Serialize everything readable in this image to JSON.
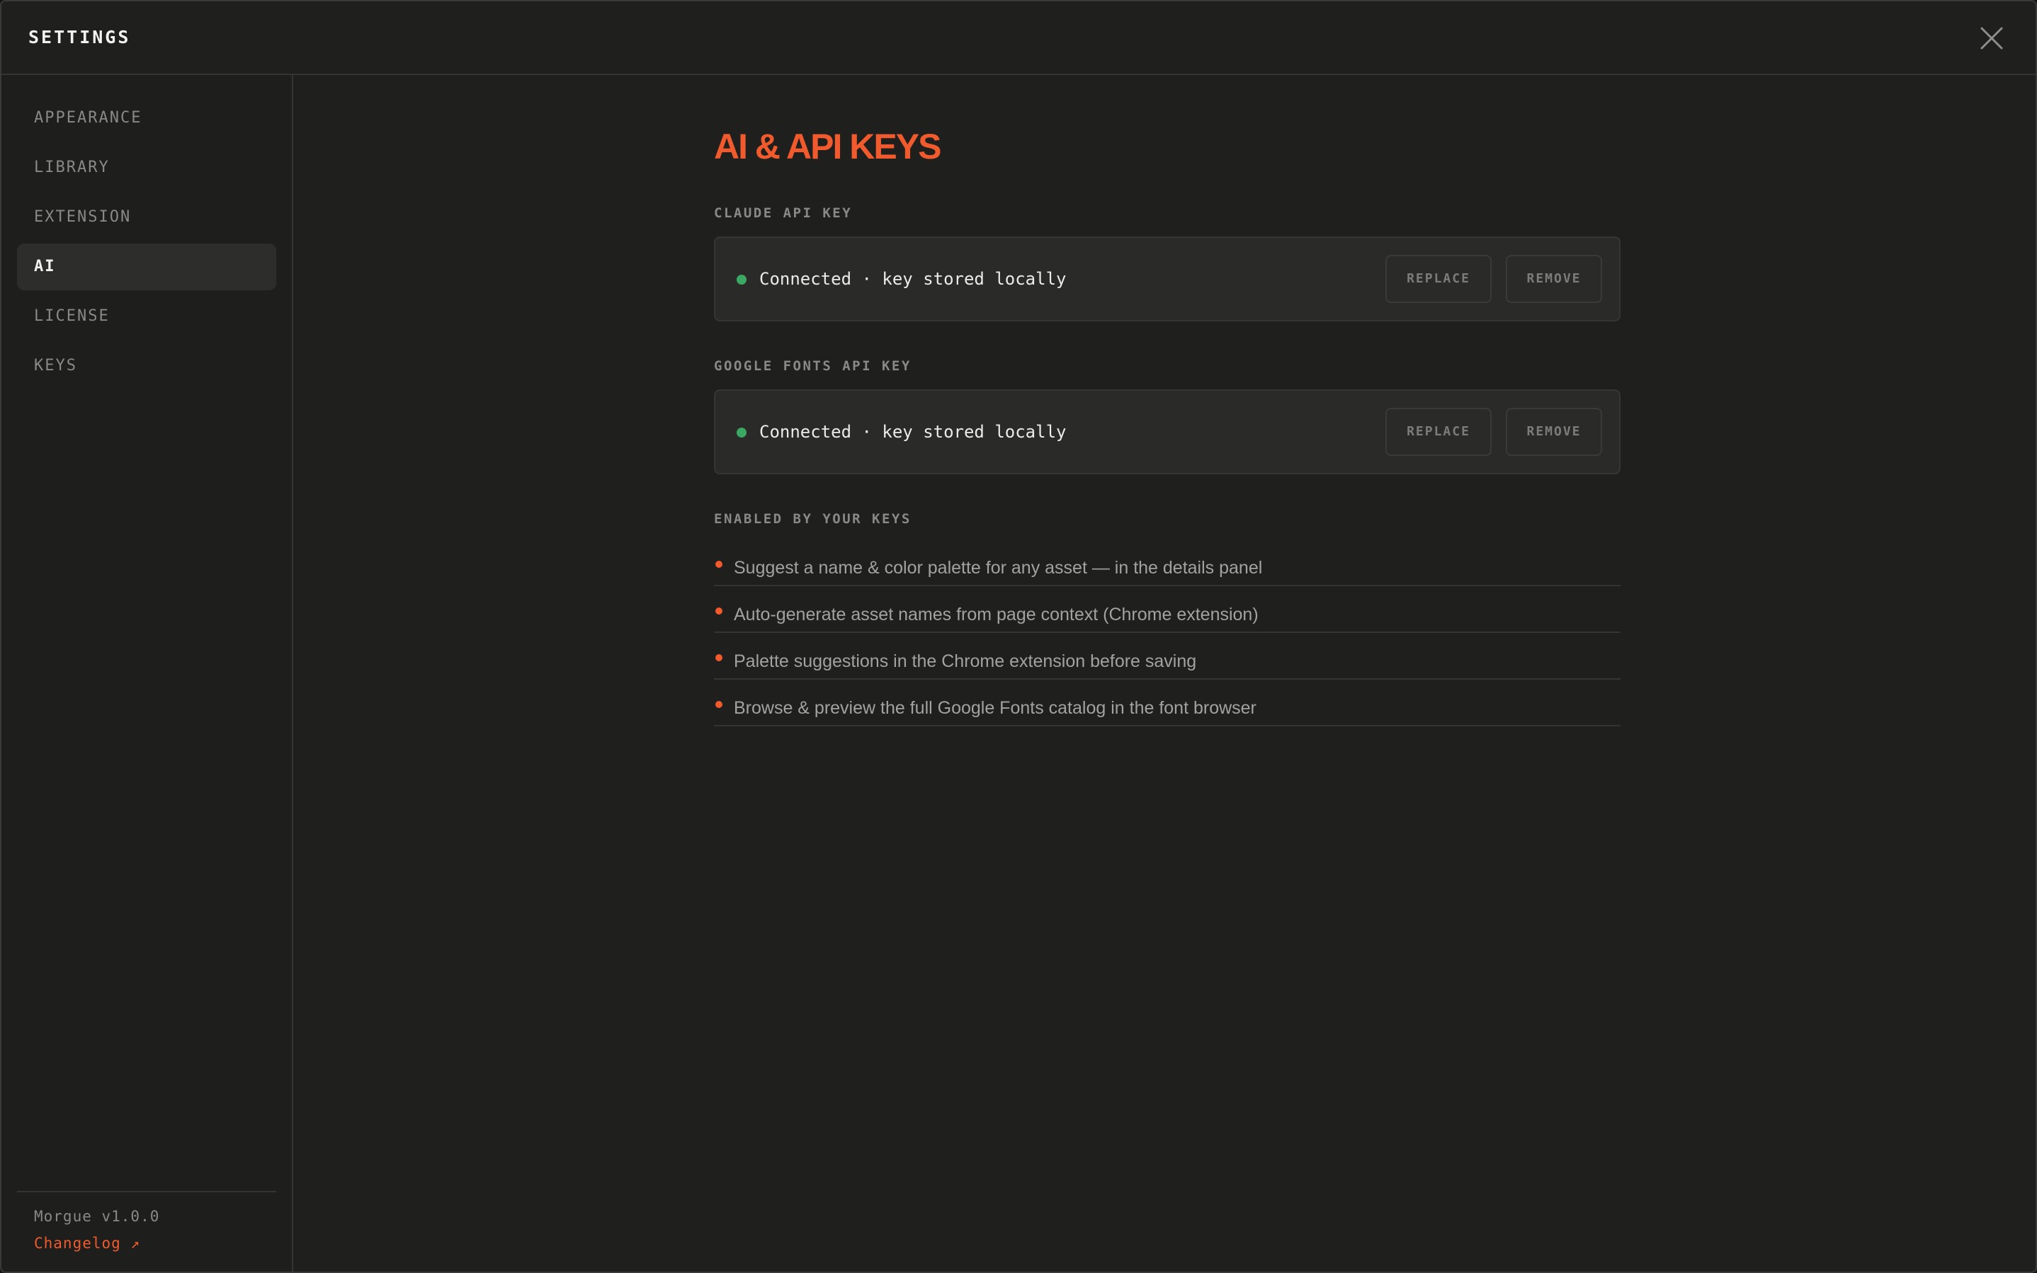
{
  "header": {
    "title": "SETTINGS",
    "close_icon": "close-icon"
  },
  "sidebar": {
    "items": [
      {
        "label": "APPEARANCE",
        "active": false
      },
      {
        "label": "LIBRARY",
        "active": false
      },
      {
        "label": "EXTENSION",
        "active": false
      },
      {
        "label": "AI",
        "active": true
      },
      {
        "label": "LICENSE",
        "active": false
      },
      {
        "label": "KEYS",
        "active": false
      }
    ],
    "version": "Morgue v1.0.0",
    "changelog": "Changelog ↗"
  },
  "main": {
    "title": "AI & API KEYS",
    "claude": {
      "label": "CLAUDE API KEY",
      "status": "Connected · key stored locally",
      "replace": "REPLACE",
      "remove": "REMOVE"
    },
    "google_fonts": {
      "label": "GOOGLE FONTS API KEY",
      "status": "Connected · key stored locally",
      "replace": "REPLACE",
      "remove": "REMOVE"
    },
    "enabled_label": "ENABLED BY YOUR KEYS",
    "features": [
      "Suggest a name & color palette for any asset — in the details panel",
      "Auto-generate asset names from page context (Chrome extension)",
      "Palette suggestions in the Chrome extension before saving",
      "Browse & preview the full Google Fonts catalog in the font browser"
    ]
  },
  "colors": {
    "accent": "#f05a2c",
    "connected": "#3aa862",
    "background": "#1f1f1e",
    "card": "#2a2a29"
  }
}
